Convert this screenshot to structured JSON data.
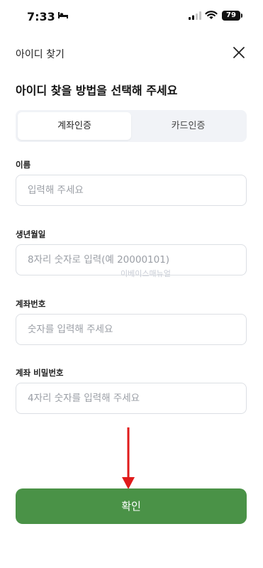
{
  "status_bar": {
    "time": "7:33",
    "battery": "79"
  },
  "header": {
    "title": "아이디 찾기",
    "close_icon": "close-icon"
  },
  "heading": "아이디 찾을 방법을 선택해 주세요",
  "method_tabs": [
    {
      "label": "계좌인증",
      "selected": true
    },
    {
      "label": "카드인증",
      "selected": false
    }
  ],
  "fields": [
    {
      "label": "이름",
      "placeholder": "입력해 주세요",
      "value": ""
    },
    {
      "label": "생년월일",
      "placeholder": "8자리 숫자로 입력(예 20000101)",
      "value": ""
    },
    {
      "label": "계좌번호",
      "placeholder": "숫자를 입력해 주세요",
      "value": ""
    },
    {
      "label": "계좌 비밀번호",
      "placeholder": "4자리 숫자를 입력해 주세요",
      "value": ""
    }
  ],
  "watermark": "이베이스매뉴얼",
  "confirm_label": "확인",
  "colors": {
    "accent": "#4a9247",
    "arrow": "#e01b1b",
    "segment_bg": "#f1f3f7"
  }
}
